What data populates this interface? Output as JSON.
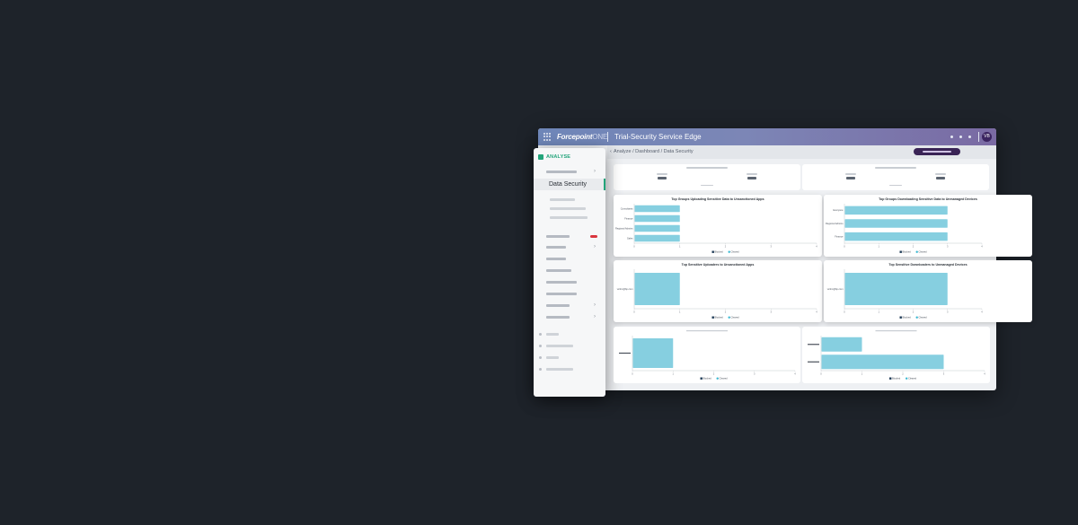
{
  "window": {
    "brand": "Forcepoint",
    "brand_suffix": "ONE",
    "title": "Trial-Security Service Edge",
    "avatar_initials": "VB"
  },
  "breadcrumb": "Analyze / Dashboard / Data Security",
  "sidebar": {
    "section_label": "ANALYSE",
    "active_item": "Data Security"
  },
  "colors": {
    "accent": "#22a47a",
    "bar": "#86cfe0",
    "legend_blocked": "#1f3b57",
    "legend_cleared": "#38b8d1",
    "purple": "#3a2456",
    "badge": "#d9363e"
  },
  "legend": {
    "blocked": "Blocked",
    "cleared": "Cleared"
  },
  "chart_data": [
    {
      "type": "bar",
      "orientation": "horizontal",
      "title": "Top Groups Uploading Sensitive Data to Unsanctioned Apps",
      "categories": [
        "Consultants",
        "Finance",
        "Regional Admins",
        "Sales"
      ],
      "values": [
        1,
        1,
        1,
        1
      ],
      "xlim": [
        0,
        4
      ],
      "xticks": [
        "0",
        "1",
        "2",
        "3",
        "4"
      ],
      "legend": [
        "Blocked",
        "Cleared"
      ]
    },
    {
      "type": "bar",
      "orientation": "horizontal",
      "title": "Top Groups Downloading Sensitive Data to Unmanaged Devices",
      "categories": [
        "Everyone",
        "Regional Admins",
        "Finance"
      ],
      "values": [
        3,
        3,
        3
      ],
      "xlim": [
        0,
        4
      ],
      "xticks": [
        "0",
        "1",
        "2",
        "3",
        "4"
      ],
      "legend": [
        "Blocked",
        "Cleared"
      ]
    },
    {
      "type": "bar",
      "orientation": "horizontal",
      "title": "Top Sensitive Uploaders to Unsanctioned Apps",
      "categories": [
        "victim@bp.com"
      ],
      "values": [
        1
      ],
      "xlim": [
        0,
        4
      ],
      "xticks": [
        "0",
        "1",
        "2",
        "3",
        "4"
      ],
      "legend": [
        "Blocked",
        "Cleared"
      ]
    },
    {
      "type": "bar",
      "orientation": "horizontal",
      "title": "Top Sensitive Downloaders to Unmanaged Devices",
      "categories": [
        "victim@bp.com"
      ],
      "values": [
        3
      ],
      "xlim": [
        0,
        4
      ],
      "xticks": [
        "0",
        "1",
        "2",
        "3",
        "4"
      ],
      "legend": [
        "Blocked",
        "Cleared"
      ]
    },
    {
      "type": "bar",
      "orientation": "horizontal",
      "title": "",
      "categories": [
        ""
      ],
      "values": [
        1
      ],
      "xlim": [
        0,
        4
      ],
      "xticks": [
        "0",
        "1",
        "2",
        "3",
        "4"
      ],
      "legend": [
        "Blocked",
        "Cleared"
      ]
    },
    {
      "type": "bar",
      "orientation": "horizontal",
      "title": "",
      "categories": [
        "",
        ""
      ],
      "values": [
        1,
        3
      ],
      "xlim": [
        0,
        4
      ],
      "xticks": [
        "0",
        "1",
        "2",
        "3",
        "4"
      ],
      "legend": [
        "Blocked",
        "Cleared"
      ]
    }
  ]
}
